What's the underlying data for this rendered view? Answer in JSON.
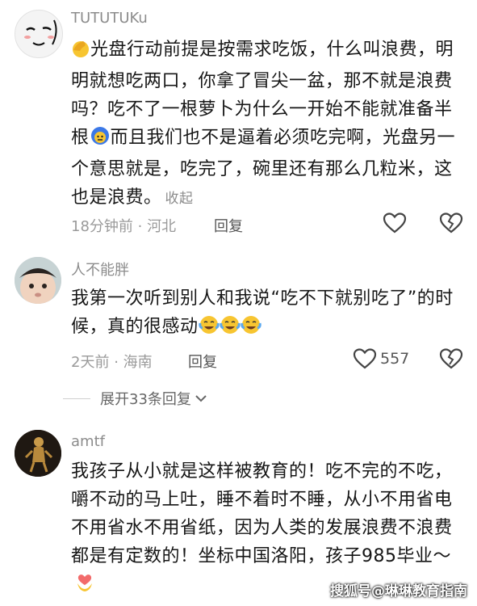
{
  "comments": [
    {
      "username": "TUTUTUKu",
      "text_part1": "光盘行动前提是按需求吃饭，什么叫浪费，明明就想吃两口，你拿了冒尖一盆，那不就是浪费吗？吃不了一根萝卜为什么一开始不能就准备半根",
      "text_part2": "而且我们也不是逼着必须吃完啊，光盘另一个意思就是，吃完了，碗里还有那么几粒米，这也是浪费。",
      "collapse_label": "收起",
      "time": "18分钟前",
      "separator": "·",
      "location": "河北",
      "reply_label": "回复"
    },
    {
      "username": "人不能胖",
      "text": "我第一次听到别人和我说“吃不下就别吃了”的时候，真的很感动",
      "time": "2天前",
      "separator": "·",
      "location": "海南",
      "reply_label": "回复",
      "like_count": "557"
    },
    {
      "username": "amtf",
      "text": "我孩子从小就是这样被教育的！吃不完的不吃，嚼不动的马上吐，睡不着时不睡，从小不用省电不用省水不用省纸，因为人类的发展浪费不浪费都是有定数的！坐标中国洛阳，孩子985毕业～"
    }
  ],
  "expand_replies_label": "展开33条回复",
  "watermark": "搜狐号@琳琳教育指南",
  "colors": {
    "meta_gray": "#9a9a9a",
    "text_dark": "#161616",
    "emoji_yellow": "#f7c531"
  }
}
